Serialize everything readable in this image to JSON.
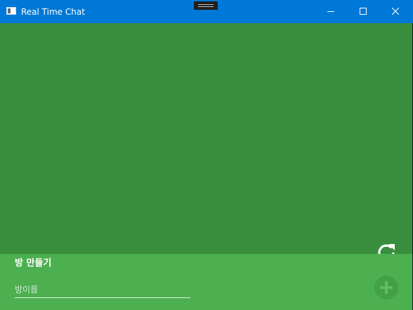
{
  "window": {
    "title": "Real Time Chat",
    "icon": "app-window-icon",
    "controls": {
      "minimize_icon": "minimize-icon",
      "maximize_icon": "maximize-icon",
      "close_icon": "close-icon"
    }
  },
  "colors": {
    "titlebar": "#0078d7",
    "content": "#388e3c",
    "panel": "#4caf50",
    "add_button": "#43a047"
  },
  "main": {
    "refresh_icon": "refresh-icon"
  },
  "create_room": {
    "title": "방 만들기",
    "input_placeholder": "방이름",
    "input_value": "",
    "add_icon": "plus-icon"
  }
}
